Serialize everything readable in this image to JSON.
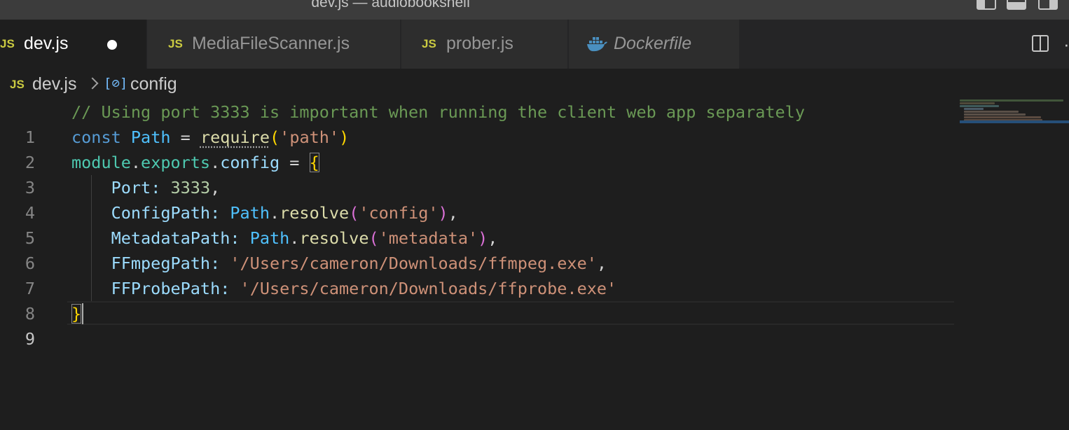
{
  "window": {
    "title": "dev.js — audiobookshelf"
  },
  "tabs": [
    {
      "icon": "JS",
      "label": "dev.js",
      "active": true,
      "modified": true
    },
    {
      "icon": "JS",
      "label": "MediaFileScanner.js",
      "active": false
    },
    {
      "icon": "JS",
      "label": "prober.js",
      "active": false
    },
    {
      "icon": "docker-icon",
      "label": "Dockerfile",
      "active": false,
      "italic": true
    }
  ],
  "breadcrumb": {
    "file_icon": "JS",
    "file": "dev.js",
    "symbol_icon": "[⊘]",
    "symbol": "config"
  },
  "editor": {
    "line_numbers": [
      "1",
      "2",
      "3",
      "4",
      "5",
      "6",
      "7",
      "8",
      "9"
    ],
    "current_line": 9,
    "lines": {
      "l1": {
        "comment": "// Using port 3333 is important when running the client web app separately"
      },
      "l2": {
        "kw": "const",
        "var": "Path",
        "eq": "=",
        "fn": "require",
        "lp": "(",
        "str": "'path'",
        "rp": ")"
      },
      "l3": {
        "obj": "module",
        "d1": ".",
        "prop1": "exports",
        "d2": ".",
        "prop2": "config",
        "eq": "=",
        "brace": "{"
      },
      "l4": {
        "key": "Port",
        "colon": ":",
        "num": "3333",
        "comma": ","
      },
      "l5": {
        "key": "ConfigPath",
        "colon": ":",
        "obj": "Path",
        "dot": ".",
        "fn": "resolve",
        "lp": "(",
        "str": "'config'",
        "rp": ")",
        "comma": ","
      },
      "l6": {
        "key": "MetadataPath",
        "colon": ":",
        "obj": "Path",
        "dot": ".",
        "fn": "resolve",
        "lp": "(",
        "str": "'metadata'",
        "rp": ")",
        "comma": ","
      },
      "l7": {
        "key": "FFmpegPath",
        "colon": ":",
        "str": "'/Users/cameron/Downloads/ffmpeg.exe'",
        "comma": ","
      },
      "l8": {
        "key": "FFProbePath",
        "colon": ":",
        "str": "'/Users/cameron/Downloads/ffprobe.exe'"
      },
      "l9": {
        "brace": "}"
      }
    }
  },
  "colors": {
    "editor_bg": "#1e1e1e",
    "tab_inactive_bg": "#2d2d2d",
    "js_icon": "#cbcb41",
    "comment": "#6a9955",
    "keyword": "#569cd6",
    "string": "#ce9178",
    "function": "#dcdcaa",
    "property": "#9cdcfe",
    "number": "#b5cea8"
  }
}
